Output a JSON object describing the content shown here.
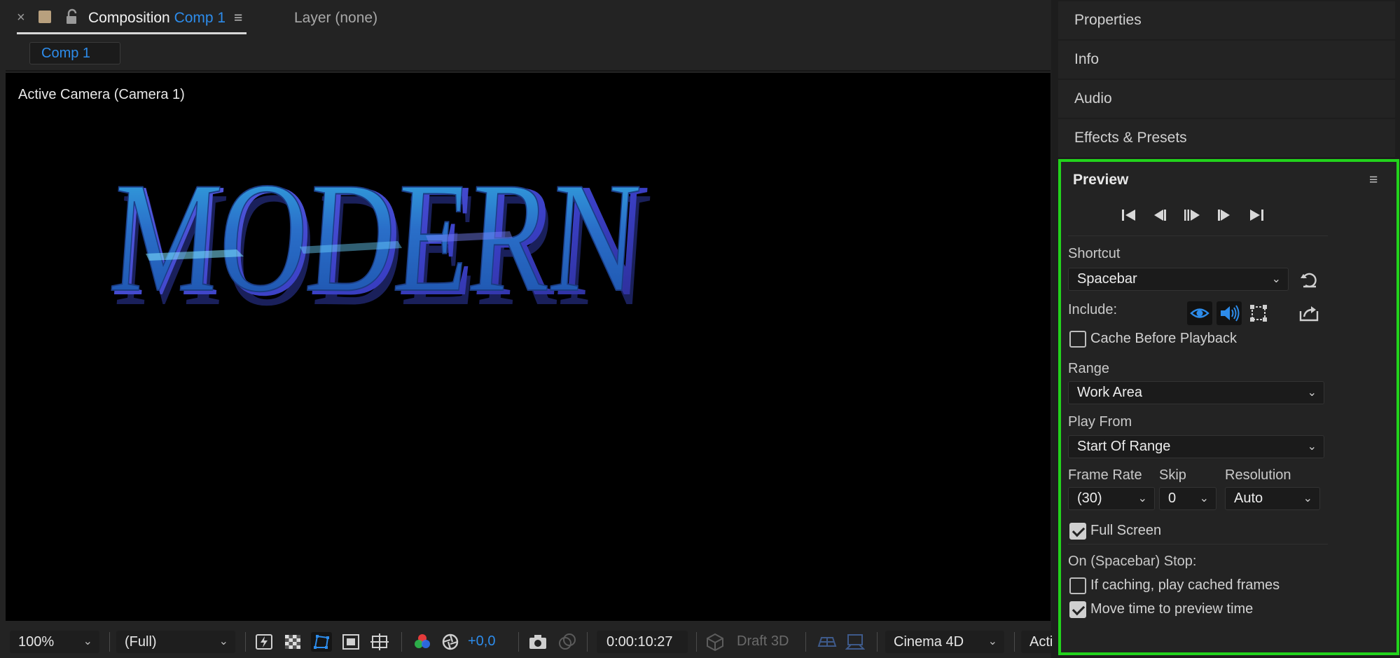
{
  "composition_panel": {
    "close_glyph": "×",
    "tab_menu_glyph": "≡",
    "tab_title_prefix": "Composition",
    "tab_title_comp": "Comp 1",
    "layer_tab": "Layer (none)",
    "comp_chip": "Comp 1"
  },
  "viewer": {
    "camera_label": "Active Camera (Camera 1)",
    "render_text": "MODERN"
  },
  "toolbar": {
    "zoom": "100%",
    "resolution": "(Full)",
    "exposure": "+0,0",
    "timecode": "0:00:10:27",
    "draft3d": "Draft 3D",
    "renderer": "Cinema 4D",
    "view_truncated": "Acti",
    "chevron_glyph": "⌄"
  },
  "right_panels": {
    "headers": [
      "Properties",
      "Info",
      "Audio",
      "Effects & Presets"
    ]
  },
  "preview": {
    "title": "Preview",
    "menu_glyph": "≡",
    "shortcut_label": "Shortcut",
    "shortcut_value": "Spacebar",
    "include_label": "Include:",
    "cache_before_playback": {
      "label": "Cache Before Playback",
      "checked": false
    },
    "range_label": "Range",
    "range_value": "Work Area",
    "play_from_label": "Play From",
    "play_from_value": "Start Of Range",
    "frame_rate_label": "Frame Rate",
    "frame_rate_value": "(30)",
    "skip_label": "Skip",
    "skip_value": "0",
    "resolution_label": "Resolution",
    "resolution_value": "Auto",
    "full_screen": {
      "label": "Full Screen",
      "checked": true
    },
    "on_stop_label": "On (Spacebar) Stop:",
    "if_caching": {
      "label": "If caching, play cached frames",
      "checked": false
    },
    "move_time": {
      "label": "Move time to preview time",
      "checked": true
    }
  },
  "colors": {
    "accent_blue": "#2d8ceb",
    "highlight_green": "#22d31c",
    "panel_bg": "#232323"
  }
}
